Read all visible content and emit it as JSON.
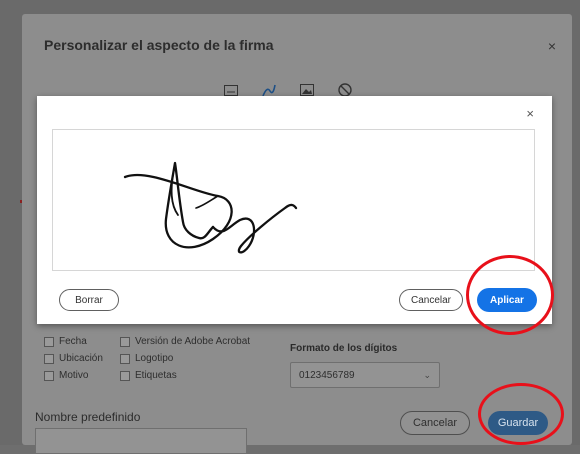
{
  "outer_dialog": {
    "title": "Personalizar el aspecto de la firma",
    "close_glyph": "×",
    "mode_icons": [
      "text-mode-icon",
      "draw-mode-icon",
      "image-mode-icon",
      "none-mode-icon"
    ],
    "checkboxes_left": [
      "Fecha",
      "Ubicación",
      "Motivo"
    ],
    "checkboxes_right": [
      "Versión de Adobe Acrobat",
      "Logotipo",
      "Etiquetas"
    ],
    "digits_format_label": "Formato de los dígitos",
    "digits_format_value": "0123456789",
    "preset_name_label": "Nombre predefinido",
    "cancel_label": "Cancelar",
    "save_label": "Guardar"
  },
  "signature_dialog": {
    "close_glyph": "×",
    "clear_label": "Borrar",
    "cancel_label": "Cancelar",
    "apply_label": "Aplicar"
  },
  "colors": {
    "accent_blue": "#1473e6",
    "annotation_red": "#e8101a"
  }
}
